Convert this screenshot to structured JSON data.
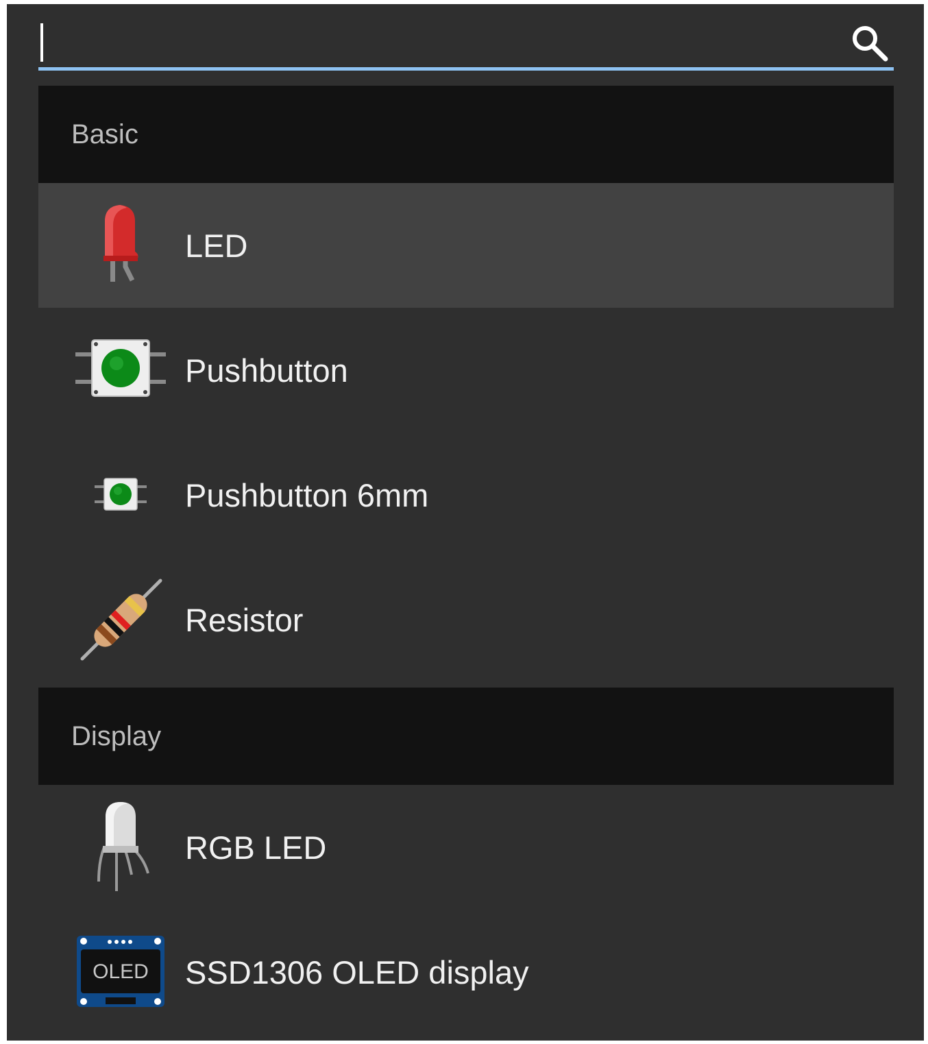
{
  "search": {
    "value": "",
    "placeholder": ""
  },
  "sections": [
    {
      "title": "Basic",
      "items": [
        {
          "label": "LED",
          "icon": "red-led-icon",
          "selected": true
        },
        {
          "label": "Pushbutton",
          "icon": "pushbutton-icon"
        },
        {
          "label": "Pushbutton 6mm",
          "icon": "pushbutton-6mm-icon"
        },
        {
          "label": "Resistor",
          "icon": "resistor-icon"
        }
      ]
    },
    {
      "title": "Display",
      "items": [
        {
          "label": "RGB LED",
          "icon": "rgb-led-icon"
        },
        {
          "label": "SSD1306 OLED display",
          "icon": "oled-display-icon",
          "icon_text": "OLED"
        }
      ]
    }
  ],
  "colors": {
    "panel": "#2f2f2f",
    "section_header": "#121212",
    "selected_row": "#424242",
    "accent_underline": "#8ec2f2"
  }
}
